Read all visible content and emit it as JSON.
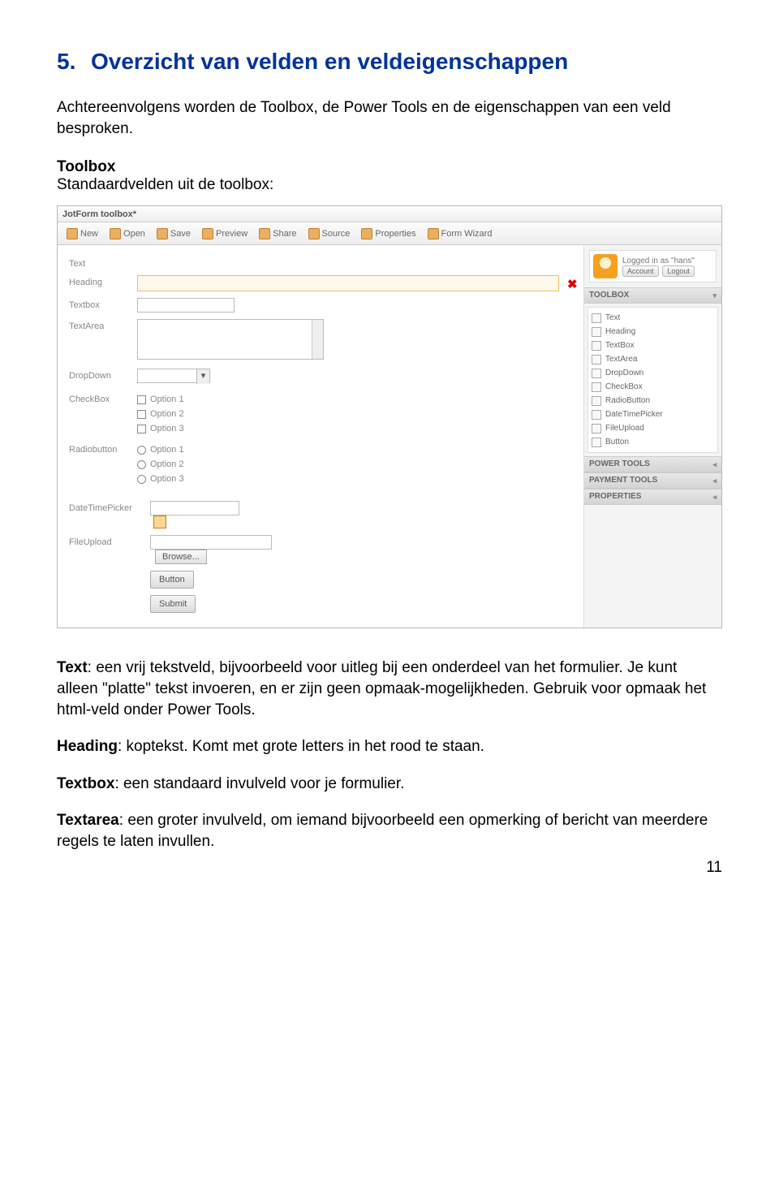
{
  "heading": {
    "num": "5.",
    "title": "Overzicht van velden en veldeigenschappen"
  },
  "intro": "Achtereenvolgens worden de Toolbox, de Power Tools en de eigenschappen van een veld besproken.",
  "toolbox_title": "Toolbox",
  "toolbox_sub": "Standaardvelden uit de toolbox:",
  "shot": {
    "titlebar": "JotForm toolbox*",
    "toolbar": [
      {
        "label": "New"
      },
      {
        "label": "Open"
      },
      {
        "label": "Save"
      },
      {
        "label": "Preview"
      },
      {
        "label": "Share"
      },
      {
        "label": "Source"
      },
      {
        "label": "Properties"
      },
      {
        "label": "Form Wizard"
      }
    ],
    "rows": {
      "text": "Text",
      "heading": "Heading",
      "textbox": "Textbox",
      "textarea": "TextArea",
      "dropdown": "DropDown",
      "checkbox": "CheckBox",
      "cb_opts": [
        "Option 1",
        "Option 2",
        "Option 3"
      ],
      "radiobutton": "Radiobutton",
      "rb_opts": [
        "Option 1",
        "Option 2",
        "Option 3"
      ],
      "datetime": "DateTimePicker",
      "fileupload": "FileUpload",
      "browse": "Browse...",
      "button": "Button",
      "submit": "Submit"
    },
    "side": {
      "logged": "Logged in as \"hans\"",
      "account": "Account",
      "logout": "Logout",
      "panel_toolbox": "TOOLBOX",
      "items": [
        "Text",
        "Heading",
        "TextBox",
        "TextArea",
        "DropDown",
        "CheckBox",
        "RadioButton",
        "DateTimePicker",
        "FileUpload",
        "Button"
      ],
      "panel_power": "POWER TOOLS",
      "panel_payment": "PAYMENT TOOLS",
      "panel_properties": "PROPERTIES"
    }
  },
  "desc": {
    "text_label": "Text",
    "text_body": ": een vrij tekstveld, bijvoorbeeld voor uitleg bij een onderdeel van het formulier. Je kunt alleen \"platte\" tekst invoeren, en er zijn geen opmaak-mogelijkheden. Gebruik voor opmaak het html-veld onder Power Tools.",
    "heading_label": "Heading",
    "heading_body": ": koptekst. Komt met grote letters in het rood te staan.",
    "textbox_label": "Textbox",
    "textbox_body": ": een standaard invulveld voor je formulier.",
    "textarea_label": "Textarea",
    "textarea_body": ": een groter invulveld, om iemand bijvoorbeeld een opmerking of bericht van meerdere regels te laten invullen."
  },
  "pagenum": "11"
}
